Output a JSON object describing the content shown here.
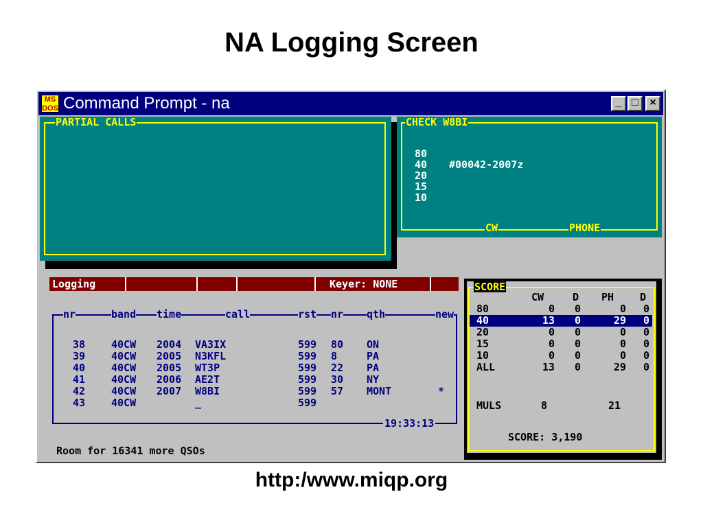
{
  "slide": {
    "title": "NA Logging Screen",
    "footer_url": "http:/www.miqp.org"
  },
  "window": {
    "title": "Command Prompt - na",
    "icon_text": "MS DOS",
    "minimize_label": "_",
    "maximize_label": "□",
    "close_label": "×"
  },
  "partial_calls": {
    "label": "PARTIAL CALLS"
  },
  "check_box": {
    "label": "CHECK W8BI",
    "bands": [
      "80",
      "40",
      "20",
      "15",
      "10"
    ],
    "entry_40": "#00042-2007z",
    "footer_cw": "CW",
    "footer_phone": "PHONE"
  },
  "status_bar": {
    "mode": "Logging",
    "keyer": "Keyer: NONE"
  },
  "log": {
    "header": "nr",
    "columns": [
      "nr",
      "band",
      "time",
      "call",
      "rst",
      "nr",
      "qth",
      "new"
    ],
    "rows": [
      {
        "nr": "38",
        "band": "40CW",
        "time": "2004",
        "call": "VA3IX",
        "rst": "599",
        "nr2": "80",
        "qth": "ON",
        "new": ""
      },
      {
        "nr": "39",
        "band": "40CW",
        "time": "2005",
        "call": "N3KFL",
        "rst": "599",
        "nr2": "8",
        "qth": "PA",
        "new": ""
      },
      {
        "nr": "40",
        "band": "40CW",
        "time": "2005",
        "call": "WT3P",
        "rst": "599",
        "nr2": "22",
        "qth": "PA",
        "new": ""
      },
      {
        "nr": "41",
        "band": "40CW",
        "time": "2006",
        "call": "AE2T",
        "rst": "599",
        "nr2": "30",
        "qth": "NY",
        "new": ""
      },
      {
        "nr": "42",
        "band": "40CW",
        "time": "2007",
        "call": "W8BI",
        "rst": "599",
        "nr2": "57",
        "qth": "MONT",
        "new": "*"
      },
      {
        "nr": "43",
        "band": "40CW",
        "time": "",
        "call": "_",
        "rst": "599",
        "nr2": "",
        "qth": "",
        "new": ""
      }
    ],
    "clock": "19:33:13",
    "room_message": "Room for 16341 more QSOs"
  },
  "score": {
    "label": "SCORE",
    "headers": [
      "",
      "CW",
      "D",
      "PH",
      "D"
    ],
    "rows": [
      {
        "band": "80",
        "cw": "0",
        "d1": "0",
        "ph": "0",
        "d2": "0",
        "highlight": false
      },
      {
        "band": "40",
        "cw": "13",
        "d1": "0",
        "ph": "29",
        "d2": "0",
        "highlight": true
      },
      {
        "band": "20",
        "cw": "0",
        "d1": "0",
        "ph": "0",
        "d2": "0",
        "highlight": false
      },
      {
        "band": "15",
        "cw": "0",
        "d1": "0",
        "ph": "0",
        "d2": "0",
        "highlight": false
      },
      {
        "band": "10",
        "cw": "0",
        "d1": "0",
        "ph": "0",
        "d2": "0",
        "highlight": false
      },
      {
        "band": "ALL",
        "cw": "13",
        "d1": "0",
        "ph": "29",
        "d2": "0",
        "highlight": false
      }
    ],
    "muls_label": "MULS",
    "muls_cw": "8",
    "muls_ph": "21",
    "total": "SCORE: 3,190"
  },
  "colors": {
    "teal": "#008080",
    "yellow": "#ffff00",
    "navy": "#00007f",
    "dark_red": "#800000",
    "console_grey": "#c0c0c0"
  }
}
